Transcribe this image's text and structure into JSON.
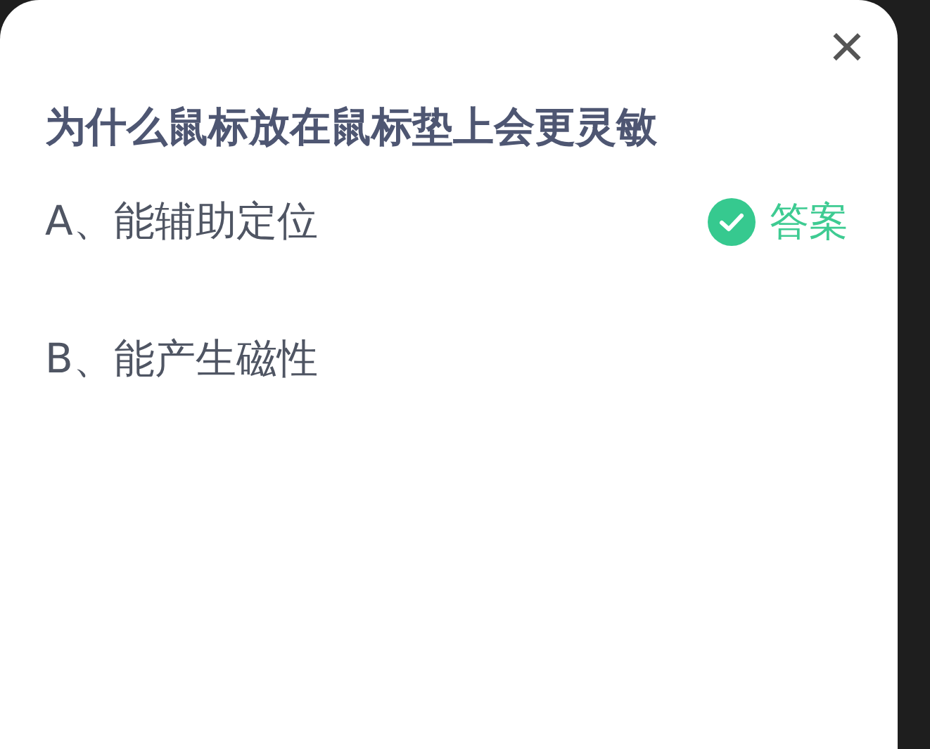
{
  "dialog": {
    "close": "×"
  },
  "question": "为什么鼠标放在鼠标垫上会更灵敏",
  "answer_label": "答案",
  "options": [
    {
      "label": "A、能辅助定位",
      "correct": true
    },
    {
      "label": "B、能产生磁性",
      "correct": false
    }
  ]
}
